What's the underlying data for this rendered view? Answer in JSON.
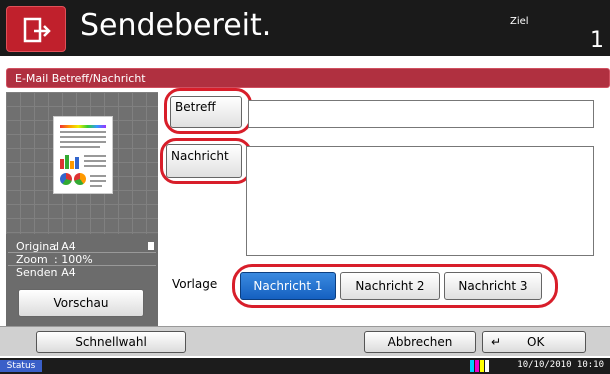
{
  "header": {
    "title": "Sendebereit.",
    "ziel_label": "Ziel",
    "ziel_count": "1"
  },
  "section": {
    "title": "E-Mail Betreff/Nachricht"
  },
  "preview": {
    "original_key": "Original",
    "original_val": ": A4",
    "zoom_key": "Zoom",
    "zoom_val": ": 100%",
    "senden_key": "Senden",
    "senden_val": ": A4",
    "button": "Vorschau"
  },
  "form": {
    "subject_button": "Betreff",
    "subject_value": "",
    "message_button": "Nachricht",
    "message_value": "",
    "template_label": "Vorlage",
    "templates": [
      "Nachricht 1",
      "Nachricht 2",
      "Nachricht 3"
    ],
    "selected_template": "Nachricht 1"
  },
  "footer": {
    "quick": "Schnellwahl",
    "cancel": "Abbrechen",
    "ok": "OK"
  },
  "status": {
    "label": "Status",
    "datetime": "10/10/2010  10:10"
  },
  "colors": {
    "accent": "#c0202c",
    "highlight": "#d81e2a",
    "selected": "#1560c0"
  }
}
